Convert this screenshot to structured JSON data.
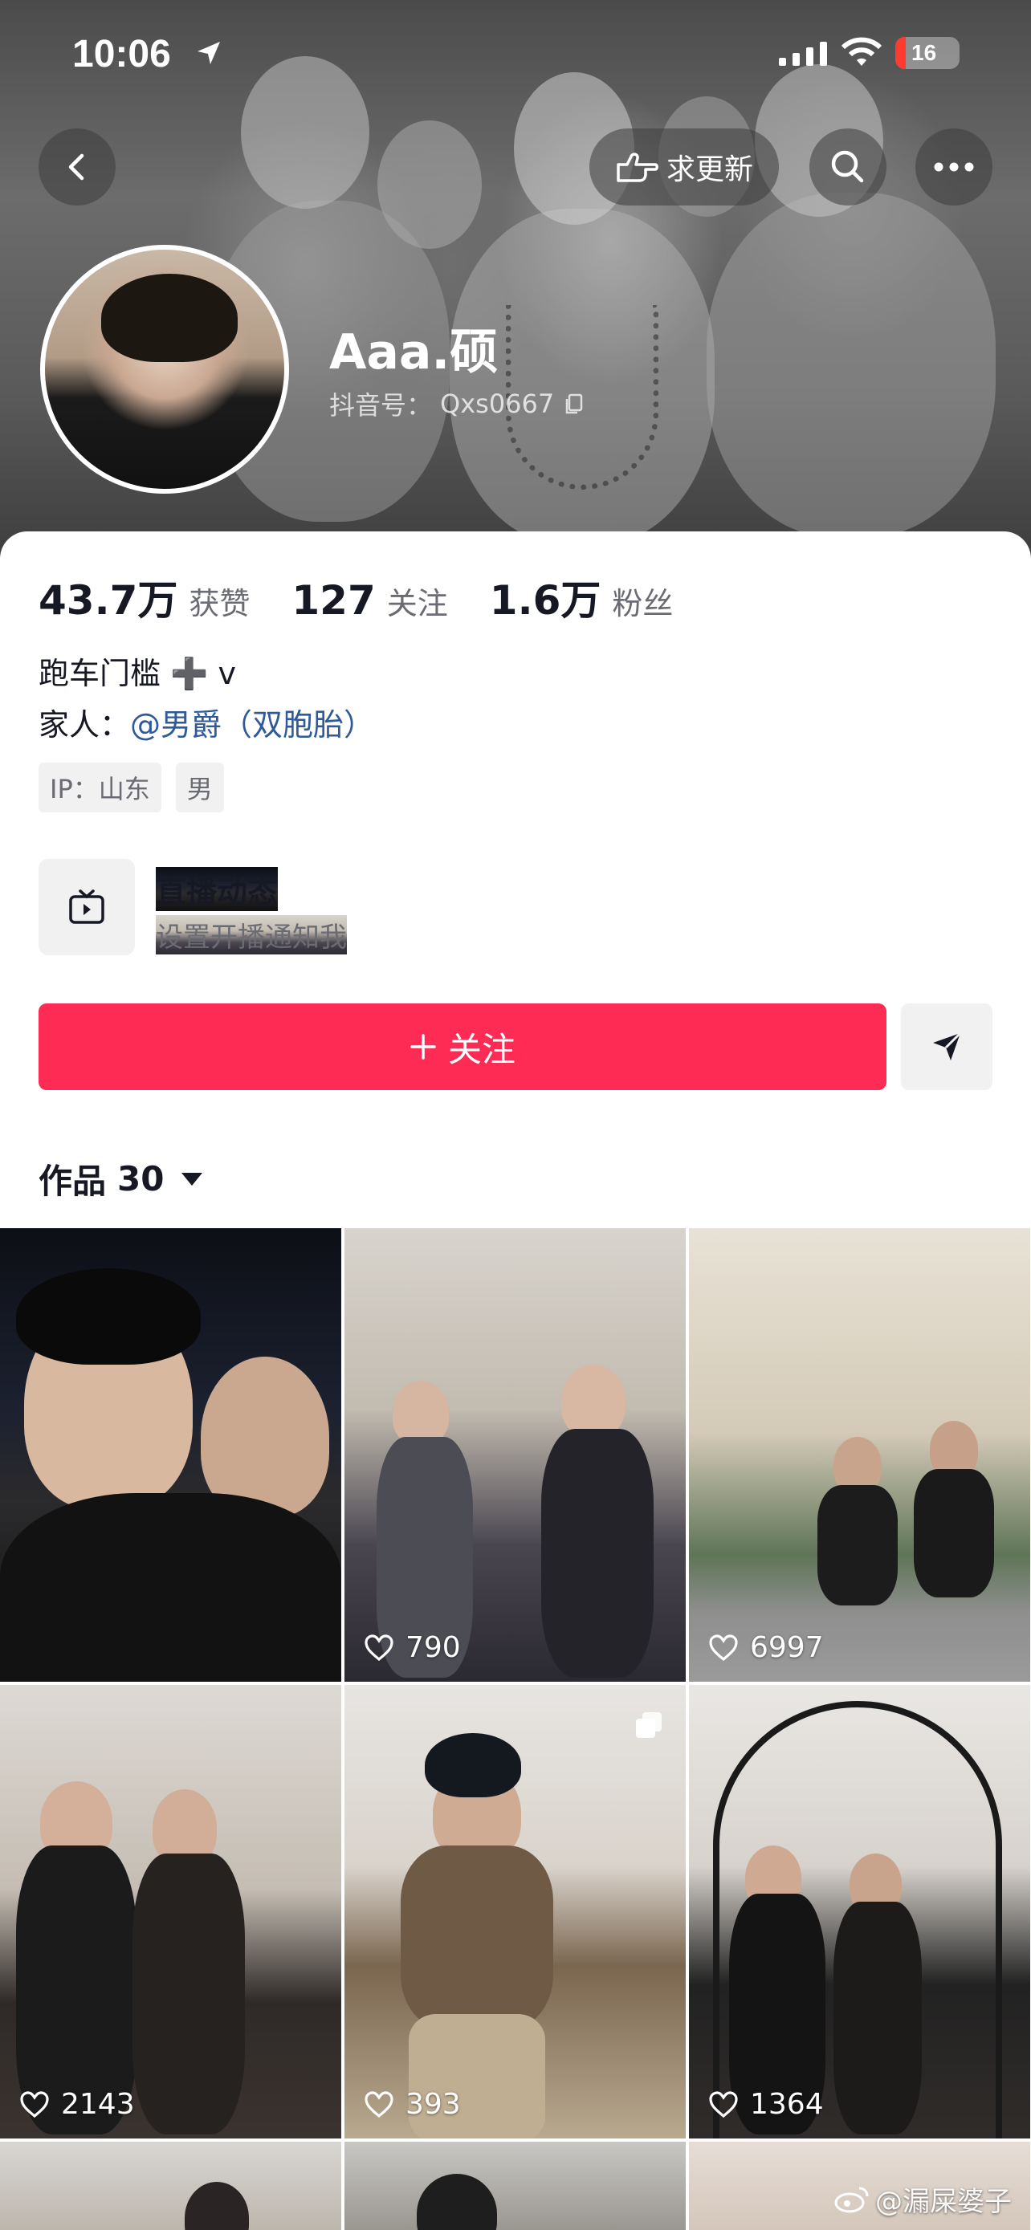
{
  "status_bar": {
    "time": "10:06",
    "battery": "16",
    "battery_level_percent": 16
  },
  "header": {
    "update_label": "求更新"
  },
  "profile": {
    "name": "Aaa.硕",
    "douyin_id_label": "抖音号：",
    "douyin_id": "Qxs0667"
  },
  "stats": [
    {
      "value": "43.7万",
      "label": "获赞"
    },
    {
      "value": "127",
      "label": "关注"
    },
    {
      "value": "1.6万",
      "label": "粉丝"
    }
  ],
  "bio": {
    "line1": "跑车门槛 ➕ v",
    "line2_prefix": "家人：",
    "line2_link": "@男爵（双胞胎）"
  },
  "tags": [
    "IP：山东",
    "男"
  ],
  "live": {
    "title": "直播动态",
    "subtitle": "设置开播通知我"
  },
  "follow_button": {
    "label": "关注"
  },
  "works": {
    "label": "作品",
    "count": "30"
  },
  "grid": [
    {
      "likes": ""
    },
    {
      "likes": "790"
    },
    {
      "likes": "6997"
    },
    {
      "likes": "2143"
    },
    {
      "likes": "393"
    },
    {
      "likes": "1364"
    }
  ],
  "watermark": "@漏屎婆子",
  "colors": {
    "follow": "#fe2c55",
    "link": "#2e5a9b",
    "text": "#161823",
    "secondary": "#6a6b73"
  }
}
